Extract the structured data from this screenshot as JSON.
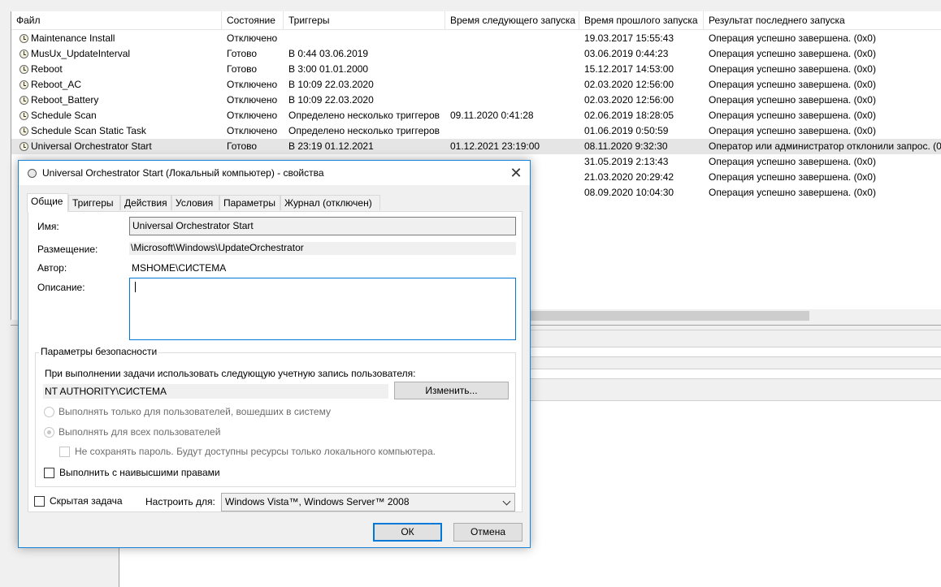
{
  "list": {
    "columns": [
      "Файл",
      "Состояние",
      "Триггеры",
      "Время следующего запуска",
      "Время прошлого запуска",
      "Результат последнего запуска"
    ],
    "rows": [
      {
        "name": "Maintenance Install",
        "status": "Отключено",
        "trigger": "",
        "next": "",
        "last": "19.03.2017 15:55:43",
        "result": "Операция успешно завершена. (0x0)"
      },
      {
        "name": "MusUx_UpdateInterval",
        "status": "Готово",
        "trigger": "В 0:44 03.06.2019",
        "next": "",
        "last": "03.06.2019 0:44:23",
        "result": "Операция успешно завершена. (0x0)"
      },
      {
        "name": "Reboot",
        "status": "Готово",
        "trigger": "В 3:00 01.01.2000",
        "next": "",
        "last": "15.12.2017 14:53:00",
        "result": "Операция успешно завершена. (0x0)"
      },
      {
        "name": "Reboot_AC",
        "status": "Отключено",
        "trigger": "В 10:09 22.03.2020",
        "next": "",
        "last": "02.03.2020 12:56:00",
        "result": "Операция успешно завершена. (0x0)"
      },
      {
        "name": "Reboot_Battery",
        "status": "Отключено",
        "trigger": "В 10:09 22.03.2020",
        "next": "",
        "last": "02.03.2020 12:56:00",
        "result": "Операция успешно завершена. (0x0)"
      },
      {
        "name": "Schedule Scan",
        "status": "Отключено",
        "trigger": "Определено несколько триггеров",
        "next": "09.11.2020 0:41:28",
        "last": "02.06.2019 18:28:05",
        "result": "Операция успешно завершена. (0x0)"
      },
      {
        "name": "Schedule Scan Static Task",
        "status": "Отключено",
        "trigger": "Определено несколько триггеров",
        "next": "",
        "last": "01.06.2019 0:50:59",
        "result": "Операция успешно завершена. (0x0)"
      },
      {
        "name": "Universal Orchestrator Start",
        "status": "Готово",
        "trigger": "В 23:19 01.12.2021",
        "next": "01.12.2021 23:19:00",
        "last": "08.11.2020 9:32:30",
        "result": "Оператор или администратор отклонили запрос. (0"
      },
      {
        "name": "",
        "status": "",
        "trigger": "",
        "next": "",
        "last": "31.05.2019 2:13:43",
        "result": "Операция успешно завершена. (0x0)"
      },
      {
        "name": "",
        "status": "",
        "trigger": "",
        "next": "",
        "last": "21.03.2020 20:29:42",
        "result": "Операция успешно завершена. (0x0)"
      },
      {
        "name": "",
        "status": "",
        "trigger": "",
        "next": "",
        "last": "08.09.2020 10:04:30",
        "result": "Операция успешно завершена. (0x0)"
      }
    ]
  },
  "dialog": {
    "title": "Universal Orchestrator Start (Локальный компьютер) - свойства",
    "tabs": [
      "Общие",
      "Триггеры",
      "Действия",
      "Условия",
      "Параметры",
      "Журнал (отключен)"
    ],
    "name_label": "Имя:",
    "name_value": "Universal Orchestrator Start",
    "location_label": "Размещение:",
    "location_value": "\\Microsoft\\Windows\\UpdateOrchestrator",
    "author_label": "Автор:",
    "author_value": "MSHOME\\СИСТЕМА",
    "description_label": "Описание:",
    "description_value": "",
    "security": {
      "title": "Параметры безопасности",
      "account_prompt": "При выполнении задачи использовать следующую учетную запись пользователя:",
      "account_value": "NT AUTHORITY\\СИСТЕМА",
      "change_button": "Изменить...",
      "radio_logged_on": "Выполнять только для пользователей, вошедших в систему",
      "radio_all_users": "Выполнять для всех пользователей",
      "no_store_password": "Не сохранять пароль. Будут доступны ресурсы только локального компьютера.",
      "highest_privileges": "Выполнить с наивысшими правами"
    },
    "hidden_label": "Скрытая задача",
    "configure_label": "Настроить для:",
    "configure_value": "Windows Vista™, Windows Server™ 2008",
    "ok": "ОК",
    "cancel": "Отмена"
  }
}
